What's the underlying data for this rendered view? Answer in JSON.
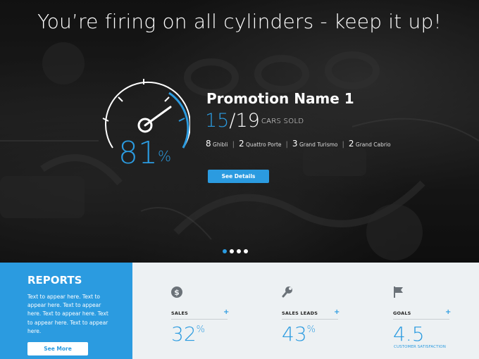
{
  "hero": {
    "headline": "You’re firing on all cylinders - keep it up!",
    "gauge_percent": "81",
    "gauge_percent_sign": "%",
    "gauge_fraction": 0.81,
    "promo_title": "Promotion Name 1",
    "sold_current": "15",
    "sold_separator": "/",
    "sold_total": "19",
    "sold_label": "CARS SOLD",
    "models": [
      {
        "count": "8",
        "name": "Ghibli"
      },
      {
        "count": "2",
        "name": "Quattro Porte"
      },
      {
        "count": "3",
        "name": "Grand Turismo"
      },
      {
        "count": "2",
        "name": "Grand Cabrio"
      }
    ],
    "separator": "|",
    "details_button": "See Details",
    "carousel_active_index": 0,
    "carousel_count": 4
  },
  "reports": {
    "title": "REPORTS",
    "text": "Text to appear here. Text to appear here. Text to appear here. Text to appear here. Text to appear here. Text to appear here.",
    "more_button": "See More"
  },
  "stats": [
    {
      "icon": "dollar-icon",
      "label": "SALES",
      "plus": "+",
      "value": "32",
      "sup": "%",
      "sub": ""
    },
    {
      "icon": "wrench-icon",
      "label": "SALES LEADS",
      "plus": "+",
      "value": "43",
      "sup": "%",
      "sub": ""
    },
    {
      "icon": "flag-icon",
      "label": "GOALS",
      "plus": "+",
      "value": "4.5",
      "sup": "",
      "sub": "CUSTOMER SATISFACTION"
    }
  ],
  "colors": {
    "accent": "#2b9be0",
    "panel": "#edf1f3",
    "hero_bg": "#1b1b1b"
  }
}
